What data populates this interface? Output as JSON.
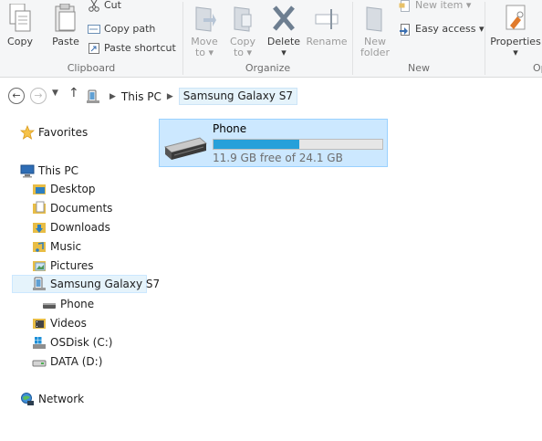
{
  "ribbon": {
    "clipboard": {
      "label": "Clipboard",
      "copy": "Copy",
      "paste": "Paste",
      "cut": "Cut",
      "copy_path": "Copy path",
      "paste_shortcut": "Paste shortcut"
    },
    "organize": {
      "label": "Organize",
      "move_to": "Move",
      "move_to_2": "to",
      "copy_to": "Copy",
      "copy_to_2": "to",
      "delete": "Delete",
      "rename": "Rename"
    },
    "new": {
      "label": "New",
      "new_folder": "New",
      "new_folder_2": "folder",
      "new_item": "New item",
      "easy_access": "Easy access"
    },
    "open": {
      "label": "Op",
      "properties": "Properties"
    }
  },
  "address": {
    "crumbs": [
      "This PC",
      "Samsung Galaxy S7"
    ]
  },
  "nav": {
    "favorites": "Favorites",
    "this_pc": "This PC",
    "desktop": "Desktop",
    "documents": "Documents",
    "downloads": "Downloads",
    "music": "Music",
    "pictures": "Pictures",
    "samsung": "Samsung Galaxy S7",
    "phone": "Phone",
    "videos": "Videos",
    "osdisk": "OSDisk (C:)",
    "data": "DATA (D:)",
    "network": "Network"
  },
  "drive": {
    "name": "Phone",
    "free_text": "11.9 GB free of 24.1 GB",
    "used_fraction": 0.506,
    "bar_color": "#26a0da"
  }
}
